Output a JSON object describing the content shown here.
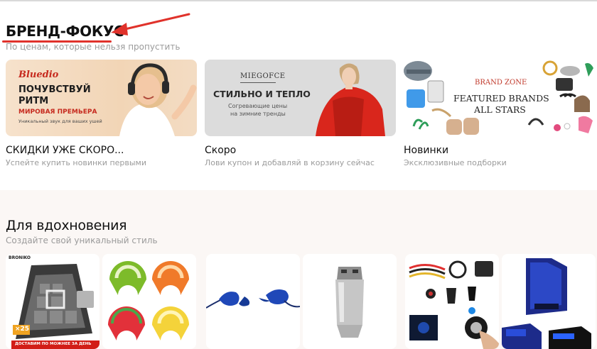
{
  "brand_focus": {
    "title": "БРЕНД-ФОКУС",
    "subtitle": "По ценам, которые нельзя пропустить",
    "banners": [
      {
        "logo": "Bluedio",
        "headline_1": "ПОЧУВСТВУЙ",
        "headline_2": "РИТМ",
        "tag": "МИРОВАЯ ПРЕМЬЕРА",
        "caption": "Уникальный звук для ваших ушей"
      },
      {
        "logo": "MIEGOFCE",
        "headline": "СТИЛЬНО И ТЕПЛО",
        "caption_1": "Согревающие цены",
        "caption_2": "на зимние тренды"
      },
      {
        "line_1": "BRAND ZONE",
        "line_2": "FEATURED BRANDS",
        "line_3": "ALL STARS"
      }
    ],
    "cards": [
      {
        "title": "СКИДКИ УЖЕ СКОРО...",
        "subtitle": "Успейте купить новинки первыми"
      },
      {
        "title": "Скоро",
        "subtitle": "Лови купон и добавляй в корзину сейчас"
      },
      {
        "title": "Новинки",
        "subtitle": "Эксклюзивные подборки"
      }
    ]
  },
  "inspiration": {
    "title": "Для вдохновения",
    "subtitle": "Создайте свой уникальный стиль",
    "product_1": {
      "brand": "BRONIKO",
      "badge": "×25",
      "ribbon": "ДОСТАВИМ ПО МОЖНЕЕ ЗА ДЕНЬ"
    }
  },
  "colors": {
    "accent": "#e0322b",
    "muted_text": "#9b9b9b"
  }
}
